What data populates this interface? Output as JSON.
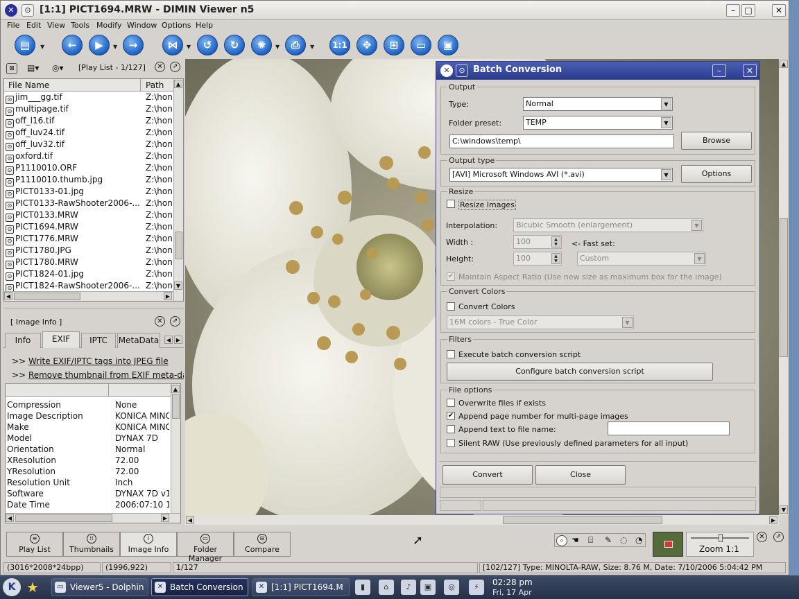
{
  "window": {
    "title": "[1:1] PICT1694.MRW - DIMIN Viewer n5",
    "app_icon": "dimin-logo-icon"
  },
  "menu": [
    "File",
    "Edit",
    "View",
    "Tools",
    "Modify",
    "Window",
    "Options",
    "Help"
  ],
  "playlist": {
    "title": "[Play List - 1/127]",
    "columns": [
      "File Name",
      "Path"
    ],
    "files": [
      {
        "name": "jim___gg.tif",
        "path": "Z:\\hon"
      },
      {
        "name": "multipage.tif",
        "path": "Z:\\hon"
      },
      {
        "name": "off_l16.tif",
        "path": "Z:\\hon"
      },
      {
        "name": "off_luv24.tif",
        "path": "Z:\\hon"
      },
      {
        "name": "off_luv32.tif",
        "path": "Z:\\hon"
      },
      {
        "name": "oxford.tif",
        "path": "Z:\\hon"
      },
      {
        "name": "P1110010.ORF",
        "path": "Z:\\hon"
      },
      {
        "name": "P1110010.thumb.jpg",
        "path": "Z:\\hon"
      },
      {
        "name": "PICT0133-01.jpg",
        "path": "Z:\\hon"
      },
      {
        "name": "PICT0133-RawShooter2006-...",
        "path": "Z:\\hon"
      },
      {
        "name": "PICT0133.MRW",
        "path": "Z:\\hon"
      },
      {
        "name": "PICT1694.MRW",
        "path": "Z:\\hon"
      },
      {
        "name": "PICT1776.MRW",
        "path": "Z:\\hon"
      },
      {
        "name": "PICT1780.JPG",
        "path": "Z:\\hon"
      },
      {
        "name": "PICT1780.MRW",
        "path": "Z:\\hon"
      },
      {
        "name": "PICT1824-01.jpg",
        "path": "Z:\\hon"
      },
      {
        "name": "PICT1824-RawShooter2006-...",
        "path": "Z:\\hon"
      },
      {
        "name": "PICT1824.MRW",
        "path": "Z:\\hon"
      }
    ]
  },
  "imageinfo": {
    "title": "[ Image Info ]",
    "tabs": [
      "Info",
      "EXIF",
      "IPTC",
      "MetaData"
    ],
    "link1": "Write EXIF/IPTC tags into JPEG file",
    "link2": "Remove thumbnail from EXIF meta-dat",
    "link_prefix": ">>",
    "rows": [
      {
        "k": "Compression",
        "v": "None"
      },
      {
        "k": "Image Description",
        "v": "KONICA MINO"
      },
      {
        "k": "Make",
        "v": "KONICA MINO"
      },
      {
        "k": "Model",
        "v": "DYNAX 7D"
      },
      {
        "k": "Orientation",
        "v": "Normal"
      },
      {
        "k": "XResolution",
        "v": "72.00"
      },
      {
        "k": "YResolution",
        "v": "72.00"
      },
      {
        "k": "Resolution Unit",
        "v": "Inch"
      },
      {
        "k": "Software",
        "v": "DYNAX 7D v1."
      },
      {
        "k": "Date Time",
        "v": "2006:07:10 1"
      }
    ]
  },
  "bottom_buttons": [
    "Play List",
    "Thumbnails",
    "Image Info",
    "Folder Manager",
    "Compare"
  ],
  "zoom_label": "Zoom 1:1",
  "status": {
    "dims": "(3016*2008*24bpp)",
    "coords": "(1996,922)",
    "index": "1/127",
    "info": "[102/127] Type: MINOLTA-RAW, Size: 8.76 M, Date: 7/10/2006 5:04:42 PM"
  },
  "dialog": {
    "title": "Batch Conversion",
    "output_group": "Output",
    "type_label": "Type:",
    "type_value": "Normal",
    "preset_label": "Folder preset:",
    "preset_value": "TEMP",
    "folder_value": "C:\\windows\\temp\\",
    "browse": "Browse",
    "outtype_group": "Output type",
    "outtype_value": "[AVI] Microsoft Windows AVI (*.avi)",
    "options": "Options",
    "resize_group": "Resize",
    "resize_check": "Resize Images",
    "interp_label": "Interpolation:",
    "interp_value": "Bicubic Smooth (enlargement)",
    "width_label": "Width :",
    "width_value": "100",
    "fastset_label": "<- Fast set:",
    "height_label": "Height:",
    "height_value": "100",
    "fastset_value": "Custom",
    "aspect_label": "Maintain Aspect Ratio (Use new size as maximum box for the image)",
    "colors_group": "Convert Colors",
    "colors_check": "Convert Colors",
    "colors_value": "16M colors - True Color",
    "filters_group": "Filters",
    "script_check": "Execute batch conversion script",
    "configure": "Configure batch conversion script",
    "fileopts_group": "File options",
    "overwrite": "Overwrite files if exists",
    "append_page": "Append page number for multi-page images",
    "append_text": "Append text to file name:",
    "silent_raw": "Silent RAW (Use previously defined parameters for all input)",
    "convert": "Convert",
    "close": "Close"
  },
  "taskbar": {
    "items": [
      "Viewer5 - Dolphin",
      "Batch Conversion",
      "[1:1] PICT1694.M"
    ],
    "time": "02:28 pm",
    "date": "Fri, 17 Apr"
  }
}
